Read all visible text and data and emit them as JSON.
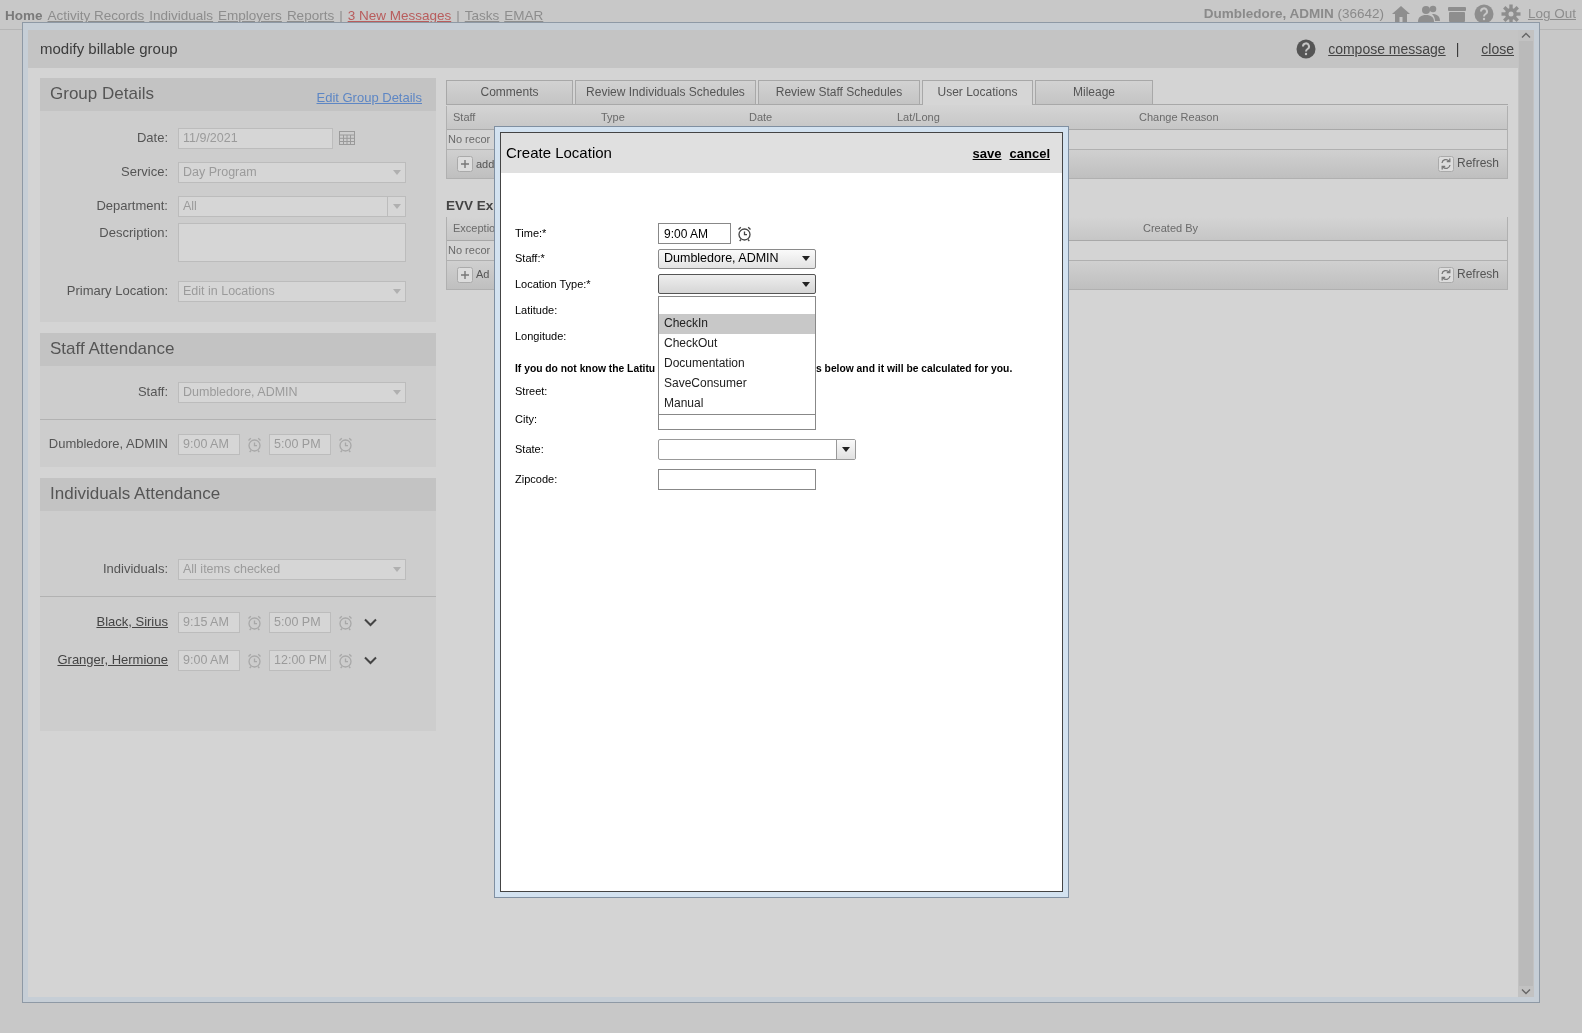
{
  "top_nav": {
    "items": [
      {
        "label": "Home",
        "kind": "current"
      },
      {
        "label": "Activity Records",
        "kind": "link"
      },
      {
        "label": "Individuals",
        "kind": "link"
      },
      {
        "label": "Employers",
        "kind": "link"
      },
      {
        "label": "Reports",
        "kind": "link"
      },
      {
        "label": "|",
        "kind": "separator"
      },
      {
        "label": "3 New Messages",
        "kind": "alert"
      },
      {
        "label": "|",
        "kind": "separator"
      },
      {
        "label": "Tasks",
        "kind": "link"
      },
      {
        "label": "EMAR",
        "kind": "link"
      }
    ],
    "user": "Dumbledore, ADMIN",
    "user_id": "(36642)",
    "logout": "Log Out"
  },
  "dialog": {
    "title": "modify billable group",
    "compose": "compose message",
    "separator": "|",
    "close": "close"
  },
  "group_details": {
    "title": "Group Details",
    "edit_link": "Edit Group Details",
    "fields": [
      {
        "label": "Date:",
        "value": "11/9/2021",
        "kind": "date"
      },
      {
        "label": "Service:",
        "value": "Day Program",
        "kind": "select"
      },
      {
        "label": "Department:",
        "value": "All",
        "kind": "combo"
      },
      {
        "label": "Description:",
        "kind": "textarea"
      },
      {
        "label": "Primary Location:",
        "value": "Edit in Locations",
        "kind": "select"
      }
    ]
  },
  "staff_attendance": {
    "title": "Staff Attendance",
    "field": {
      "label": "Staff:",
      "value": "Dumbledore, ADMIN"
    },
    "rows": [
      {
        "name": "Dumbledore, ADMIN",
        "start": "9:00 AM",
        "end": "5:00 PM"
      }
    ]
  },
  "individuals_attendance": {
    "title": "Individuals Attendance",
    "field": {
      "label": "Individuals:",
      "value": "All items checked"
    },
    "rows": [
      {
        "name": "Black, Sirius",
        "start": "9:15 AM",
        "end": "5:00 PM"
      },
      {
        "name": "Granger, Hermione",
        "start": "9:00 AM",
        "end": "12:00 PM"
      }
    ]
  },
  "tabs": [
    {
      "label": "Comments",
      "selected": false
    },
    {
      "label": "Review Individuals Schedules",
      "selected": false
    },
    {
      "label": "Review Staff Schedules",
      "selected": false
    },
    {
      "label": "User Locations",
      "selected": true
    },
    {
      "label": "Mileage",
      "selected": false
    }
  ],
  "locations_grid": {
    "columns": [
      "Staff",
      "Type",
      "Date",
      "Lat/Long",
      "Change Reason"
    ],
    "empty_text": "No recor",
    "add": "add",
    "refresh": "Refresh"
  },
  "evv_section": {
    "title": "EVV Ex",
    "columns": [
      "Exceptio",
      "Created By"
    ],
    "empty_text": "No recor",
    "add": "Ad",
    "refresh": "Refresh"
  },
  "create_location": {
    "title": "Create Location",
    "save": "save",
    "cancel": "cancel",
    "fields": [
      {
        "label": "Time:*",
        "kind": "time",
        "value": "9:00 AM"
      },
      {
        "label": "Staff:*",
        "kind": "select",
        "value": "Dumbledore, ADMIN"
      },
      {
        "label": "Location Type:*",
        "kind": "dropdown",
        "expanded": true
      },
      {
        "label": "Latitude:",
        "kind": "covered"
      },
      {
        "label": "Longitude:",
        "kind": "covered"
      },
      {
        "kind": "note",
        "text_start": "If you do not know the Latitu",
        "text_end": "s below and it will be calculated for you."
      },
      {
        "label": "Street:",
        "kind": "covered"
      },
      {
        "label": "City:",
        "kind": "text"
      },
      {
        "label": "State:",
        "kind": "state"
      },
      {
        "label": "Zipcode:",
        "kind": "text"
      }
    ],
    "options": {
      "items": [
        {
          "label": "CheckIn",
          "selected": true
        },
        {
          "label": "CheckOut",
          "selected": false
        },
        {
          "label": "Documentation",
          "selected": false
        },
        {
          "label": "SaveConsumer",
          "selected": false
        },
        {
          "label": "Manual",
          "selected": false
        }
      ]
    }
  }
}
